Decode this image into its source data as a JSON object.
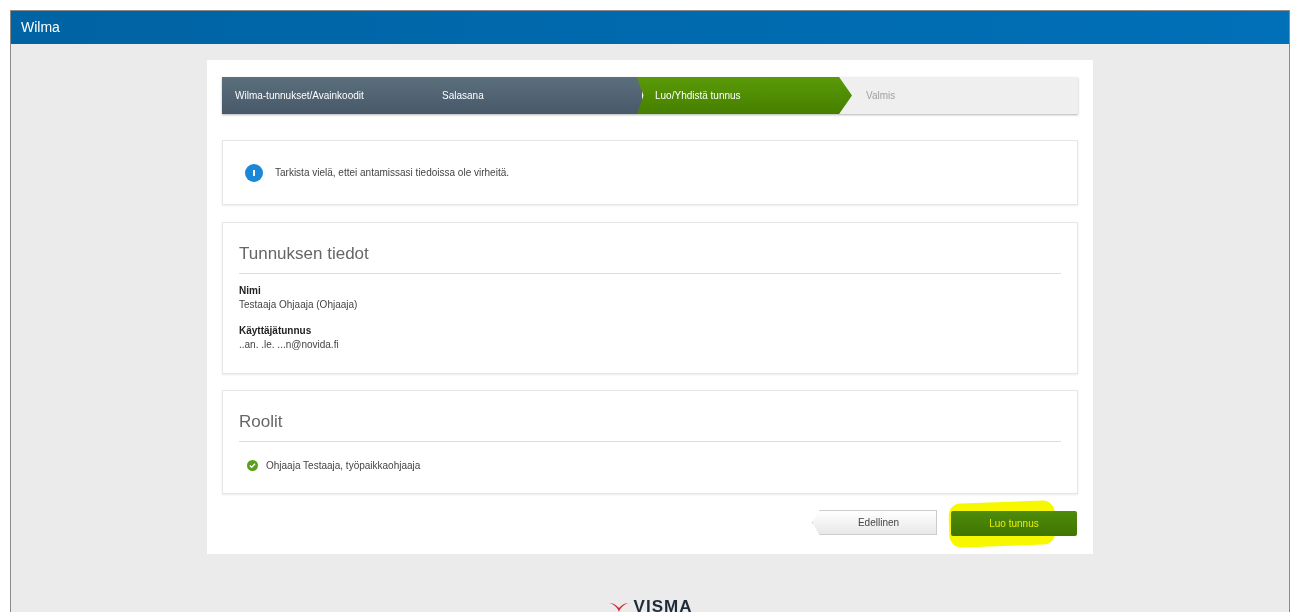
{
  "window": {
    "title": "Wilma"
  },
  "steps": [
    {
      "label": "Wilma-tunnukset/Avainkoodit",
      "completed": true,
      "selected": false
    },
    {
      "label": "Salasana",
      "completed": true,
      "selected": false
    },
    {
      "label": "Luo/Yhdistä tunnus",
      "completed": false,
      "selected": true
    },
    {
      "label": "Valmis",
      "completed": false,
      "selected": false
    }
  ],
  "notice": {
    "text": "Tarkista vielä, ettei antamissasi tiedoissa ole virheitä."
  },
  "details": {
    "title": "Tunnuksen tiedot",
    "fields": [
      {
        "label": "Nimi",
        "value": "Testaaja Ohjaaja (Ohjaaja)"
      },
      {
        "label": "Käyttäjätunnus",
        "value": "..an. .le. ...n@novida.fi"
      }
    ]
  },
  "roles": {
    "title": "Roolit",
    "items": [
      {
        "text": "Ohjaaja Testaaja, työpaikkaohjaaja",
        "checked": true
      }
    ]
  },
  "buttons": {
    "back": "Edellinen",
    "submit": {
      "label": "Luo tunnus",
      "highlighted": true
    }
  },
  "footer": {
    "logo": "VISMA"
  }
}
